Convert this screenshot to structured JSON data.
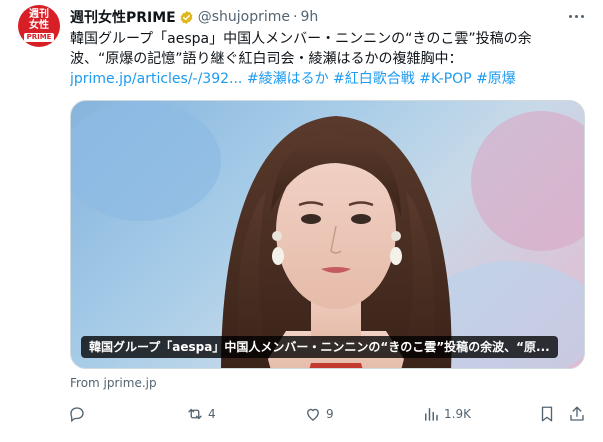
{
  "account": {
    "avatar_lines": [
      "週刊",
      "女性",
      "PRIME"
    ],
    "display_name": "週刊女性PRIME",
    "handle": "@shujoprime",
    "separator": "·",
    "time": "9h"
  },
  "tweet": {
    "line1": "韓国グループ「aespa」中国人メンバー・ニンニンの“きのこ雲”投稿の余",
    "line2": "波、“原爆の記憶”語り継ぐ紅白司会・綾瀬はるかの複雑胸中：",
    "link": "jprime.jp/articles/-/392...",
    "hashtags": [
      "#綾瀬はるか",
      "#紅白歌合戦",
      "#K-POP",
      "#原爆"
    ]
  },
  "card": {
    "caption": "韓国グループ「aespa」中国人メンバー・ニンニンの“きのこ雲”投稿の余波、“原...",
    "source": "From jprime.jp"
  },
  "actions": {
    "reply_count": "",
    "retweet_count": "4",
    "like_count": "9",
    "views_count": "1.9K"
  },
  "colors": {
    "accent": "#1d9bf0",
    "verified_gold": "#e2b719",
    "secondary_text": "#536471",
    "brand_red": "#d81f26"
  },
  "icons": [
    "more-icon",
    "verified-icon",
    "reply-icon",
    "retweet-icon",
    "like-icon",
    "views-icon",
    "bookmark-icon",
    "share-icon"
  ]
}
